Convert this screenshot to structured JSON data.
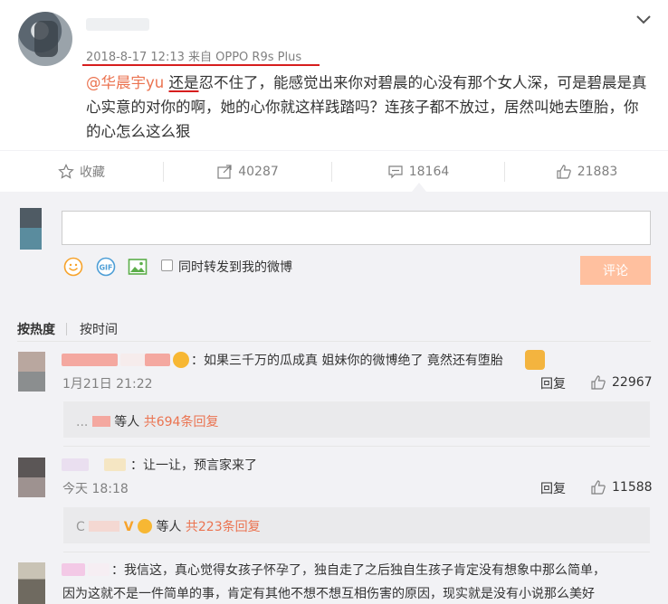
{
  "post": {
    "meta": "2018-8-17 12:13 来自 OPPO R9s Plus",
    "mention": "@华晨宇yu",
    "text_lead": "还是",
    "text_rest": "忍不住了，能感觉出来你对碧晨的心没有那个女人深，可是碧晨是真心实意的对你的啊，她的心你就这样践踏吗？连孩子都不放过，居然叫她去堕胎，你的心怎么这么狠"
  },
  "actions": {
    "favorite_label": "收藏",
    "repost_count": "40287",
    "comment_count": "18164",
    "like_count": "21883"
  },
  "composer": {
    "repost_label": "同时转发到我的微博",
    "submit_label": "评论"
  },
  "sort": {
    "hot_label": "按热度",
    "time_label": "按时间"
  },
  "comments": [
    {
      "text": "：如果三千万的瓜成真 姐妹你的微博绝了 竟然还有堕胎",
      "time": "1月21日 21:22",
      "reply_label": "回复",
      "likes": "22967",
      "sub_prefix": "...",
      "sub_middle": "等人",
      "sub_count": "共694条回复"
    },
    {
      "text": "：让一让，预言家来了",
      "time": "今天 18:18",
      "reply_label": "回复",
      "likes": "11588",
      "sub_prefix": "C",
      "sub_middle": "等人",
      "sub_count": "共223条回复"
    },
    {
      "text": "：我信这，真心觉得女孩子怀孕了，独自走了之后独自生孩子肯定没有想象中那么简单，",
      "text2": "因为这就不是一件简单的事，肯定有其他不想不想互相伤害的原因，现实就是没有小说那么美好"
    }
  ],
  "colors": {
    "accent": "#eb7350",
    "redline": "#d61d1d",
    "panel_bg": "#f2f2f5",
    "submit_bg": "#ffc09f"
  }
}
